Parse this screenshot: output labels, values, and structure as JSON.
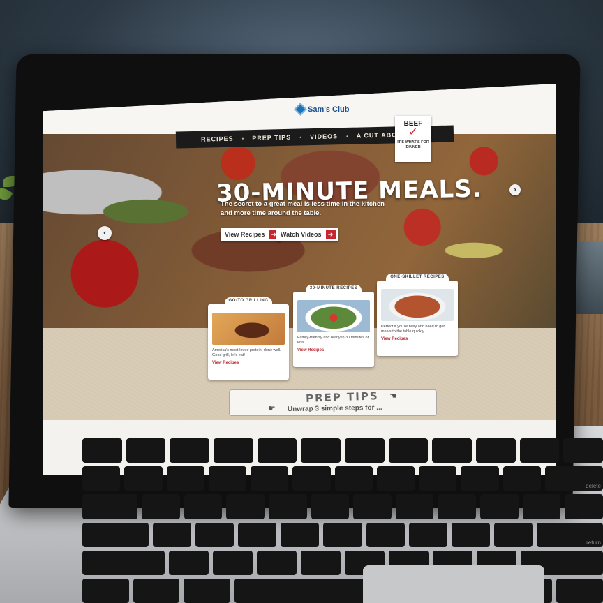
{
  "site": {
    "brand": "Sam's Club",
    "nav": [
      "RECIPES",
      "PREP TIPS",
      "VIDEOS",
      "A CUT ABOVE"
    ],
    "badge": {
      "word": "BEEF",
      "tagline": "IT'S WHAT'S FOR DINNER"
    }
  },
  "hero": {
    "title": "30-MINUTE MEALS.",
    "subtitle": "The secret to a great meal is less time in the kitchen and more time around the table.",
    "buttons": [
      "View Recipes",
      "Watch Videos"
    ]
  },
  "cards": [
    {
      "title": "GO-TO GRILLING",
      "text": "America's most-loved protein, done well. Good grill, let's eat!",
      "link": "View Recipes"
    },
    {
      "title": "30-MINUTE RECIPES",
      "text": "Family-friendly and ready in 30 minutes or less.",
      "link": "View Recipes"
    },
    {
      "title": "ONE-SKILLET RECIPES",
      "text": "Perfect if you're busy and need to get meals to the table quickly.",
      "link": "View Recipes"
    }
  ],
  "prep": {
    "title": "PREP TIPS",
    "subtitle": "Unwrap 3 simple steps for ..."
  },
  "keyboard": {
    "delete": "delete",
    "return": "return"
  }
}
